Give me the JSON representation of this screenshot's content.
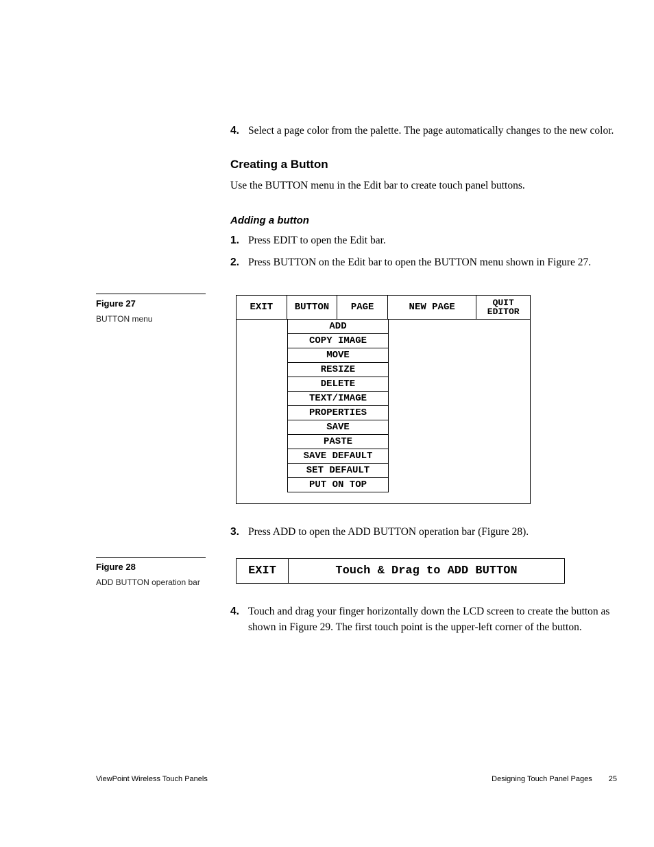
{
  "top_step": {
    "num": "4.",
    "text": "Select a page color from the palette. The page automatically changes to the new color."
  },
  "section_heading": "Creating a Button",
  "section_intro": "Use the BUTTON menu in the Edit bar to create touch panel buttons.",
  "subsection_heading": "Adding a button",
  "steps_a": [
    {
      "num": "1.",
      "text": "Press EDIT to open the Edit bar."
    },
    {
      "num": "2.",
      "text": "Press BUTTON on the Edit bar to open the BUTTON menu shown in Figure 27."
    }
  ],
  "figure27": {
    "label": "Figure 27",
    "caption": "BUTTON menu",
    "top_row": {
      "exit": "EXIT",
      "button": "BUTTON",
      "page": "PAGE",
      "new_page": "NEW PAGE",
      "quit1": "QUIT",
      "quit2": "EDITOR"
    },
    "items": [
      "ADD",
      "COPY IMAGE",
      "MOVE",
      "RESIZE",
      "DELETE",
      "TEXT/IMAGE",
      "PROPERTIES",
      "SAVE",
      "PASTE",
      "SAVE DEFAULT",
      "SET DEFAULT",
      "PUT ON TOP"
    ]
  },
  "step3": {
    "num": "3.",
    "text": "Press ADD to open the ADD BUTTON operation bar (Figure 28)."
  },
  "figure28": {
    "label": "Figure 28",
    "caption": "ADD BUTTON operation bar",
    "exit": "EXIT",
    "msg": "Touch & Drag to ADD BUTTON"
  },
  "step4": {
    "num": "4.",
    "text": "Touch and drag your finger horizontally down the LCD screen to create the button as shown in Figure 29. The first touch point is the upper-left corner of the button."
  },
  "footer": {
    "left": "ViewPoint Wireless Touch Panels",
    "right_text": "Designing Touch Panel Pages",
    "page_num": "25"
  }
}
